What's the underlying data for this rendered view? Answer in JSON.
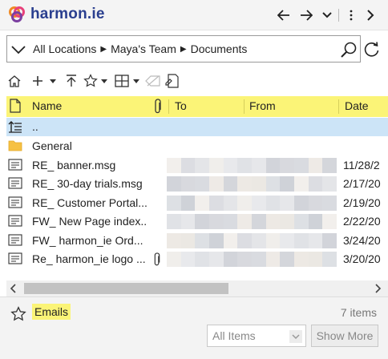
{
  "app": {
    "brand": "harmon.ie",
    "brand_colors": {
      "blue": "#2a3f8f",
      "orange": "#f08a24",
      "pink": "#e8417a",
      "purple": "#7b3fa0"
    }
  },
  "topbar": {
    "back_icon": "arrow-left-icon",
    "forward_icon": "arrow-right-icon",
    "dropdown_icon": "chevron-down-icon",
    "more_icon": "vertical-ellipsis-icon",
    "next_icon": "chevron-right-icon"
  },
  "location": {
    "crumbs": [
      "All Locations",
      "Maya's Team",
      "Documents"
    ]
  },
  "table": {
    "headers": {
      "name": "Name",
      "to": "To",
      "from": "From",
      "date": "Date"
    },
    "up_label": "..",
    "rows": [
      {
        "type": "folder",
        "name": "General",
        "date": "",
        "attachment": false
      },
      {
        "type": "email",
        "name": "RE_ banner.msg",
        "date": "11/28/2",
        "attachment": false
      },
      {
        "type": "email",
        "name": "RE_ 30-day trials.msg",
        "date": "2/17/20",
        "attachment": false
      },
      {
        "type": "email",
        "name": "RE_ Customer Portal...",
        "date": "2/19/20",
        "attachment": false
      },
      {
        "type": "email",
        "name": "FW_ New Page index..",
        "date": "2/22/20",
        "attachment": false
      },
      {
        "type": "email",
        "name": "FW_ harmon_ie Ord...",
        "date": "3/24/20",
        "attachment": false
      },
      {
        "type": "email",
        "name": "Re_ harmon_ie logo ...",
        "date": "3/20/20",
        "attachment": true
      }
    ]
  },
  "footer": {
    "view_name": "Emails",
    "count": "7 items",
    "filter_value": "All Items",
    "show_more": "Show More"
  },
  "colors": {
    "highlight": "#fbf477",
    "selected_row": "#cce4f7"
  }
}
